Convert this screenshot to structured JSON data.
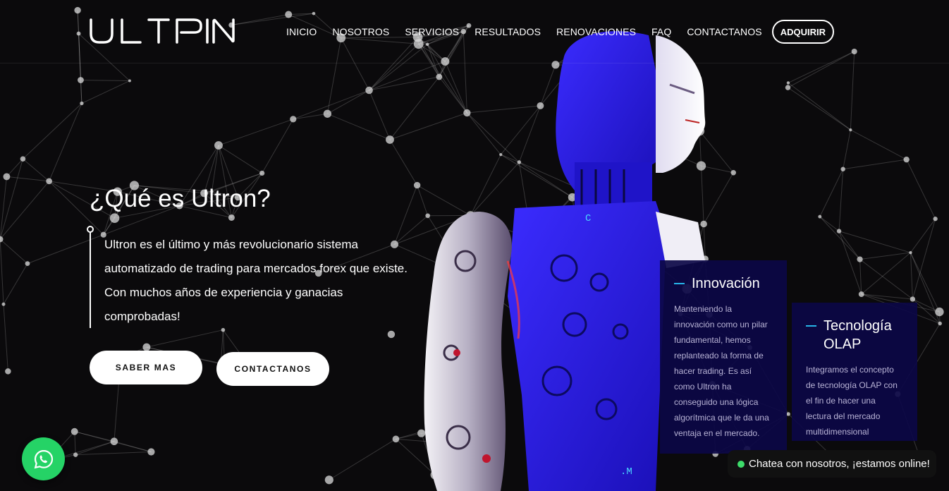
{
  "brand": {
    "logo_text": "ULTRON"
  },
  "nav": {
    "items": [
      {
        "label": "INICIO"
      },
      {
        "label": "NOSOTROS"
      },
      {
        "label": "SERVICIOS"
      },
      {
        "label": "RESULTADOS"
      },
      {
        "label": "RENOVACIONES"
      },
      {
        "label": "FAQ"
      },
      {
        "label": "CONTACTANOS"
      }
    ],
    "cta_label": "ADQUIRIR"
  },
  "hero": {
    "title": "¿Qué es Ultron?",
    "description": "Ultron es el último y más revolucionario sistema automatizado de trading para mercados forex que existe. Con muchos años de experiencia y ganacias comprobadas!",
    "primary_button": "SABER MAS",
    "secondary_button": "CONTACTANOS"
  },
  "robot_labels": {
    "top": "C",
    "bottom": ".M"
  },
  "cards": [
    {
      "title": "Innovación",
      "text": "Manteniendo la innovación como un pilar fundamental, hemos replanteado la forma de hacer trading. Es así como Ultron ha conseguido una lógica algorítmica que le da una ventaja en el mercado."
    },
    {
      "title": "Tecnología OLAP",
      "text": "Integramos el concepto de tecnología OLAP con el fin de hacer una lectura del mercado multidimensional"
    }
  ],
  "chat": {
    "bubble_text": "Chatea con nosotros, ¡estamos online!",
    "icon": "whatsapp-icon"
  },
  "colors": {
    "background": "#0b0a0c",
    "card_bg": "#0c0846",
    "accent": "#27b4e8",
    "robot_blue": "#2a1cff",
    "whatsapp": "#25d366",
    "online": "#3ddc6a"
  }
}
